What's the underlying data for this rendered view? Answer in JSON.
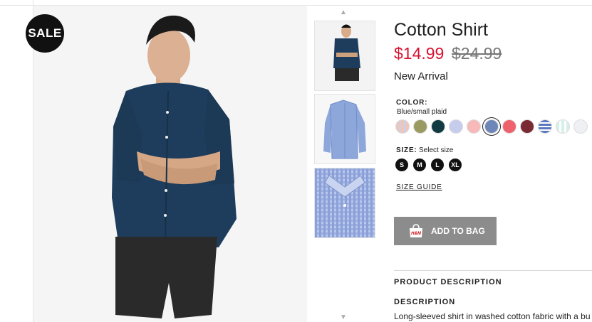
{
  "badge": {
    "sale": "SALE"
  },
  "product": {
    "title": "Cotton Shirt",
    "price_current": "$14.99",
    "price_original": "$24.99",
    "status": "New Arrival"
  },
  "color": {
    "label": "COLOR:",
    "selected_name": "Blue/small plaid",
    "swatches": [
      "#f2c4b6",
      "#9b9a62",
      "#123a43",
      "#c6cdec",
      "#f8b9b9",
      "#6f87b8",
      "#f0616e",
      "#7a2a32",
      "#5b77c2",
      "#d5efe9",
      "#eef0f4"
    ]
  },
  "size": {
    "label": "SIZE:",
    "select_text": "Select size",
    "options": [
      "S",
      "M",
      "L",
      "XL"
    ]
  },
  "links": {
    "size_guide": "SIZE GUIDE"
  },
  "actions": {
    "add_to_bag": "ADD TO BAG"
  },
  "description": {
    "section_title": "PRODUCT DESCRIPTION",
    "heading": "DESCRIPTION",
    "text": "Long-sleeved shirt in washed cotton fabric with a bu"
  },
  "colors": {
    "accent_price": "#d6122f",
    "button_bg": "#8c8c8c",
    "primary_text": "#222222"
  }
}
